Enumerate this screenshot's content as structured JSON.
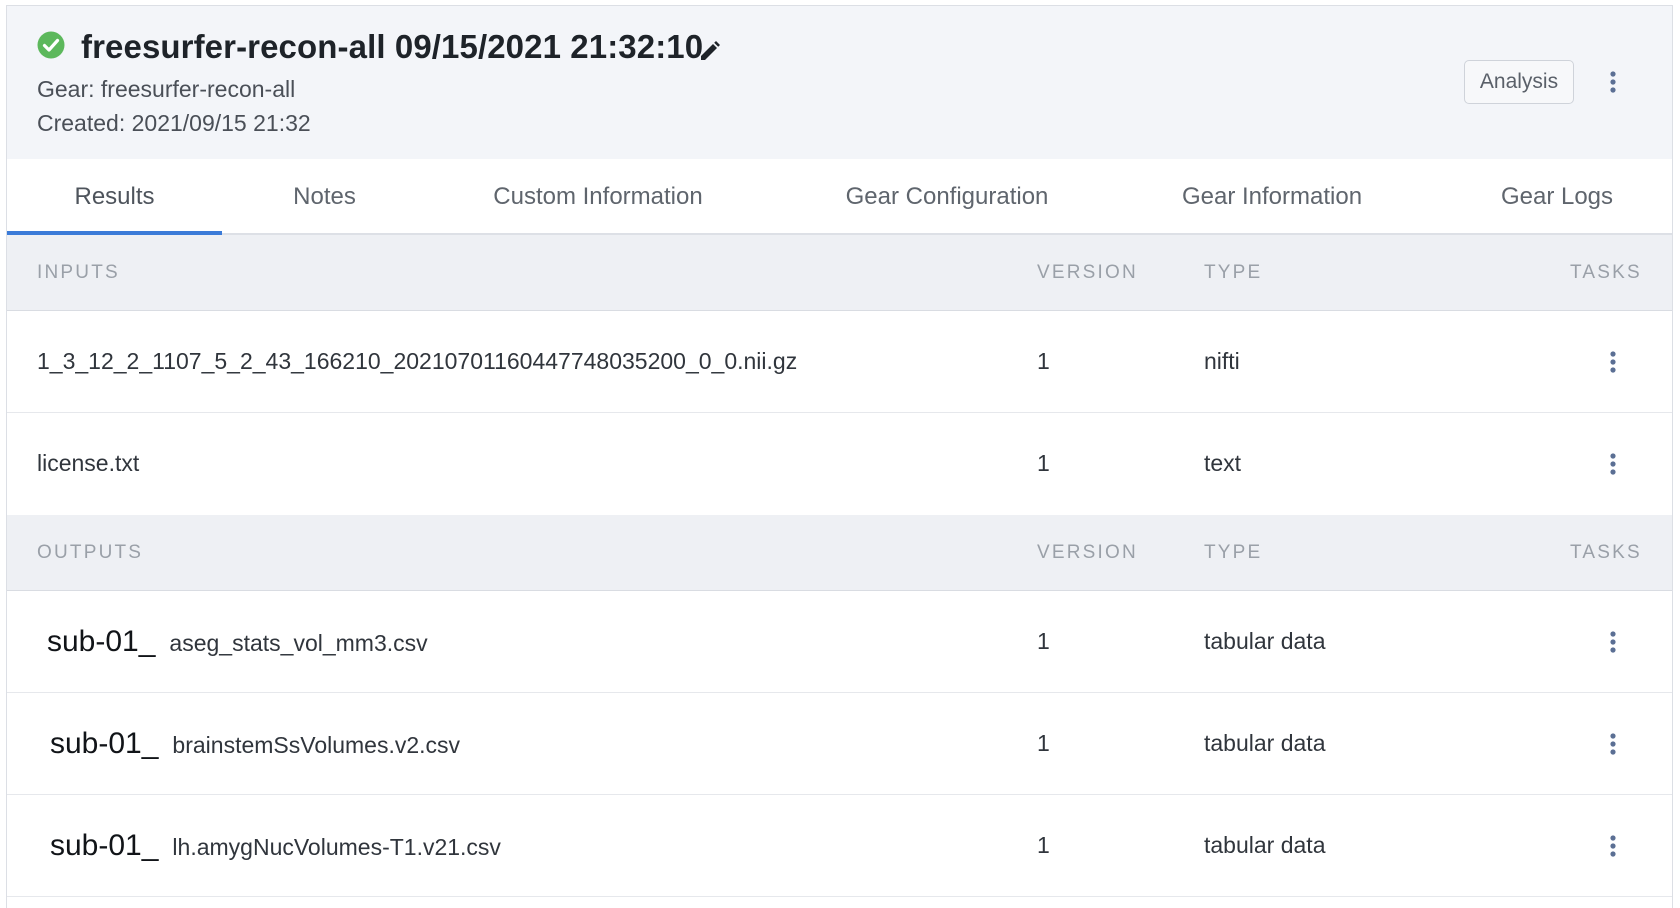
{
  "header": {
    "title": "freesurfer-recon-all 09/15/2021 21:32:10",
    "gear_line": "Gear: freesurfer-recon-all",
    "created_line": "Created: 2021/09/15 21:32",
    "analysis_button": "Analysis",
    "status": "complete",
    "status_color": "#5cb85c",
    "accent_color": "#3b7bd8"
  },
  "tabs": [
    {
      "label": "Results",
      "active": true
    },
    {
      "label": "Notes"
    },
    {
      "label": "Custom Information"
    },
    {
      "label": "Gear Configuration"
    },
    {
      "label": "Gear Information"
    },
    {
      "label": "Gear Logs"
    }
  ],
  "inputs": {
    "headers": {
      "name": "INPUTS",
      "version": "VERSION",
      "type": "TYPE",
      "tasks": "TASKS"
    },
    "rows": [
      {
        "name": "1_3_12_2_1107_5_2_43_166210_2021070116044774803520​0_0_0.nii.gz",
        "version": "1",
        "type": "nifti"
      },
      {
        "name": "license.txt",
        "version": "1",
        "type": "text"
      }
    ]
  },
  "outputs": {
    "headers": {
      "name": "OUTPUTS",
      "version": "VERSION",
      "type": "TYPE",
      "tasks": "TASKS"
    },
    "rows": [
      {
        "prefix": "sub-01_",
        "name": "aseg_stats_vol_mm3.csv",
        "version": "1",
        "type": "tabular data"
      },
      {
        "prefix": "sub-01_",
        "name": "brainstemSsVolumes.v2.csv",
        "version": "1",
        "type": "tabular data"
      },
      {
        "prefix": "sub-01_",
        "name": "lh.amygNucVolumes-T1.v21.csv",
        "version": "1",
        "type": "tabular data"
      }
    ]
  },
  "icons": {
    "status": "check-circle-icon",
    "edit": "pencil-icon",
    "menu": "kebab-menu-icon"
  }
}
